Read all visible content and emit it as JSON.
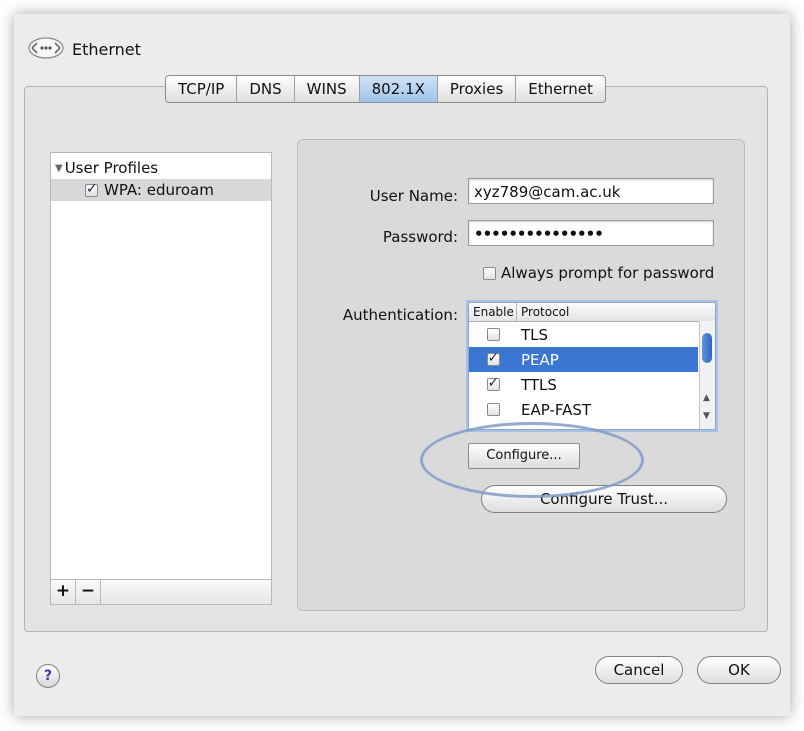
{
  "window": {
    "title": "Ethernet",
    "icon": "network-ethernet-icon"
  },
  "tabs": [
    {
      "label": "TCP/IP"
    },
    {
      "label": "DNS"
    },
    {
      "label": "WINS"
    },
    {
      "label": "802.1X",
      "active": true
    },
    {
      "label": "Proxies"
    },
    {
      "label": "Ethernet"
    }
  ],
  "profiles": {
    "group_label": "User Profiles",
    "items": [
      {
        "label": "WPA: eduroam",
        "checked": true
      }
    ],
    "add_label": "+",
    "remove_label": "−"
  },
  "settings": {
    "username_label": "User Name:",
    "username_value": "xyz789@cam.ac.uk",
    "password_label": "Password:",
    "password_value": "•••••••••••••••",
    "always_prompt_label": "Always prompt for password",
    "always_prompt_checked": false,
    "authentication_label": "Authentication:",
    "auth_table": {
      "headers": [
        "Enable",
        "Protocol"
      ],
      "rows": [
        {
          "enabled": false,
          "protocol": "TLS",
          "selected": false
        },
        {
          "enabled": true,
          "protocol": "PEAP",
          "selected": true
        },
        {
          "enabled": true,
          "protocol": "TTLS",
          "selected": false
        },
        {
          "enabled": false,
          "protocol": "EAP-FAST",
          "selected": false
        }
      ]
    },
    "configure_label": "Configure...",
    "configure_trust_label": "Configure Trust..."
  },
  "footer": {
    "help_label": "?",
    "cancel_label": "Cancel",
    "ok_label": "OK"
  },
  "colors": {
    "selection": "#3a76d2",
    "active_tab": "#b6d2f0",
    "annotation": "#829bc8"
  }
}
